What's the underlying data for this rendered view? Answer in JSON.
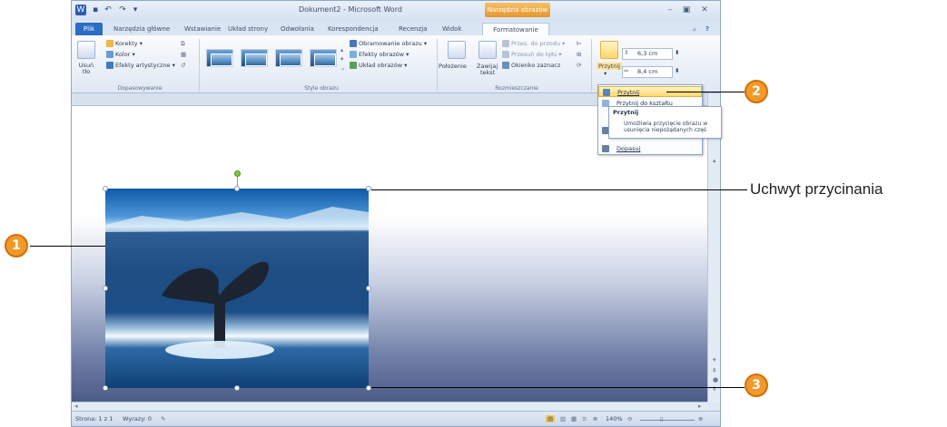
{
  "window": {
    "title": "Dokument2 - Microsoft Word",
    "context_tab_group": "Narzędzia obrazów"
  },
  "tabs": [
    "Plik",
    "Narzędzia główne",
    "Wstawianie",
    "Układ strony",
    "Odwołania",
    "Korespondencja",
    "Recenzja",
    "Widok",
    "Formatowanie"
  ],
  "ribbon": {
    "remove_bg": "Usuń tło",
    "corrections": "Korekty",
    "color": "Kolor",
    "artistic": "Efekty artystyczne",
    "group_adjust": "Dopasowywanie",
    "picture_border": "Obramowanie obrazu",
    "picture_effects": "Efekty obrazów",
    "picture_layout": "Układ obrazów",
    "group_styles": "Style obrazu",
    "position": "Położenie",
    "wrap_text_1": "Zawijaj",
    "wrap_text_2": "tekst",
    "bring_forward": "Przes. do przodu",
    "send_backward": "Przesuń do tyłu",
    "selection_pane": "Okienko zaznacz",
    "group_arrange": "Rozmieszczanie",
    "crop": "Przytnij",
    "height": "6,3 cm",
    "width": "8,4 cm"
  },
  "crop_menu": {
    "crop": "Przytnij",
    "crop_to_shape": "Przytnij do kształtu",
    "fit": "Dopasuj"
  },
  "tooltip": {
    "title": "Przytnij",
    "body": "Umożliwia przycięcie obrazu w\nusunięcia niepożądanych częś"
  },
  "status": {
    "page": "Strona: 1 z 1",
    "words": "Wyrazy: 0",
    "zoom": "140%"
  },
  "callouts": {
    "one": "1",
    "two": "2",
    "three": "3",
    "handle_label": "Uchwyt przycinania"
  }
}
